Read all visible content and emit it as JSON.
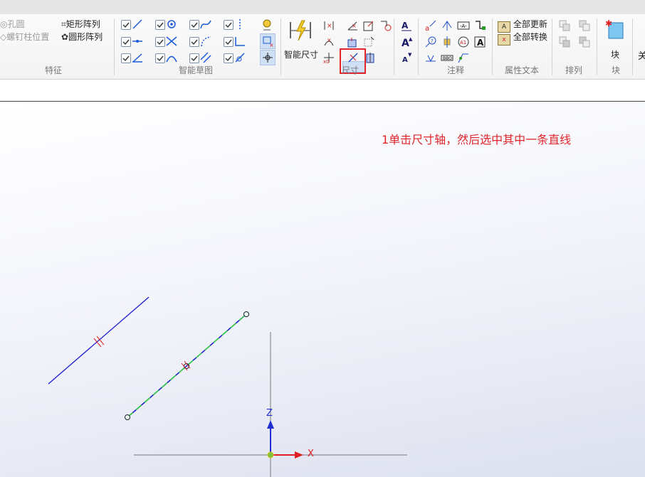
{
  "ribbon": {
    "features": {
      "hole": "孔圆",
      "bolt_position": "螺钉柱位置",
      "rect_array": "矩形阵列",
      "circ_array": "圆形阵列",
      "group_label": "特征"
    },
    "smart_sketch": {
      "group_label": "智能草图"
    },
    "dimension": {
      "smart_dim": "智能尺寸",
      "group_label": "尺寸"
    },
    "annotation": {
      "group_label": "注释"
    },
    "attribute_text": {
      "update_all": "全部更新",
      "convert_all": "全部转换",
      "group_label": "属性文本"
    },
    "arrange": {
      "group_label": "排列"
    },
    "block": {
      "button_label": "块",
      "group_label": "块"
    },
    "clipped": "关"
  },
  "canvas": {
    "instruction": "1单击尺寸轴，然后选中其中一条直线",
    "axis_x": "X",
    "axis_z": "Z"
  },
  "colors": {
    "instruction": "#e0252b",
    "highlight_box": "#e0252b",
    "line_blue": "#1a1acd",
    "line_green": "#32d23c",
    "axis_red": "#e02020",
    "axis_blue": "#2030d0"
  },
  "icons": [
    "lightning-dimension-icon",
    "dimension-axis-icon",
    "block-icon",
    "checkbox-icon",
    "line-icon",
    "circle-icon"
  ]
}
